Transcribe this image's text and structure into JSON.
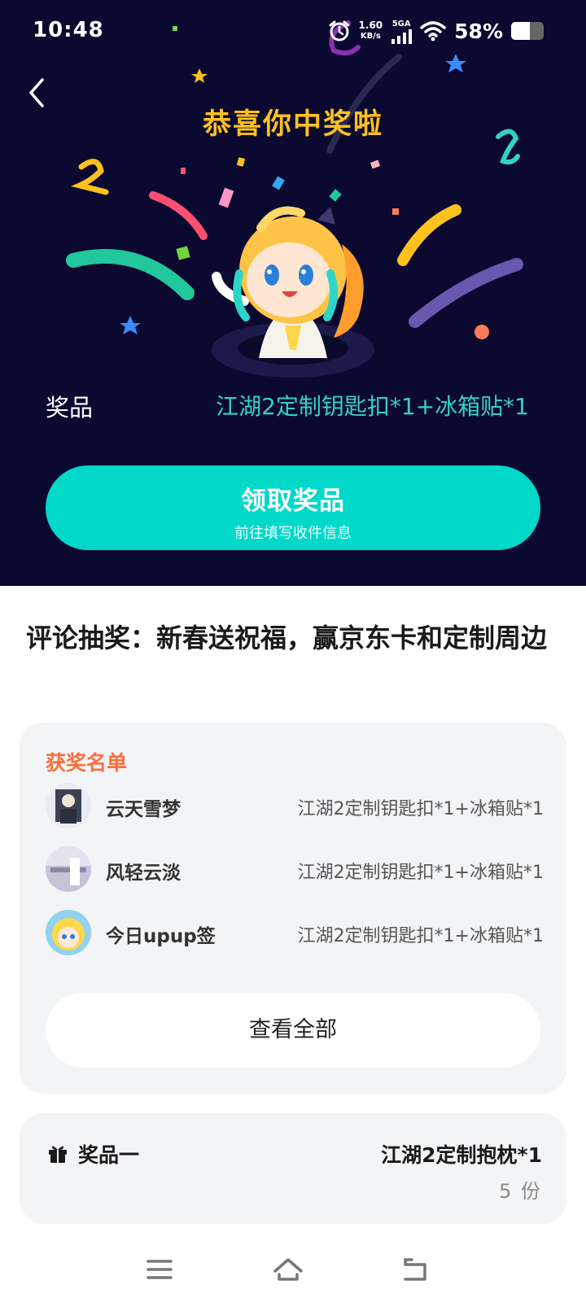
{
  "status_bar": {
    "time": "10:48",
    "speed_value": "1.60",
    "speed_unit": "KB/s",
    "network": "5GA",
    "battery_percent": "58%",
    "battery_level": 0.58
  },
  "hero": {
    "title": "恭喜你中奖啦",
    "prize_label": "奖品",
    "prize_value": "江湖2定制钥匙扣*1+冰箱贴*1",
    "claim_button": "领取奖品",
    "claim_subtext": "前往填写收件信息"
  },
  "activity": {
    "title": "评论抽奖：新春送祝福，赢京东卡和定制周边"
  },
  "winners": {
    "title": "获奖名单",
    "list": [
      {
        "name": "云天雪梦",
        "prize": "江湖2定制钥匙扣*1+冰箱贴*1"
      },
      {
        "name": "风轻云淡",
        "prize": "江湖2定制钥匙扣*1+冰箱贴*1"
      },
      {
        "name": "今日upup签",
        "prize": "江湖2定制钥匙扣*1+冰箱贴*1"
      }
    ],
    "view_all": "查看全部"
  },
  "prize_item": {
    "label": "奖品一",
    "name": "江湖2定制抱枕*1",
    "count": "5 份"
  },
  "colors": {
    "hero_bg": "#0b0930",
    "title_gold": "#ffc21c",
    "accent_teal": "#00d8c9",
    "prize_teal": "#33d3c2",
    "winners_orange": "#fb6f3c"
  },
  "icons": [
    "back-arrow-icon",
    "alarm-icon",
    "signal-icon",
    "wifi-icon",
    "battery-icon",
    "gift-icon",
    "menu-icon",
    "home-icon",
    "return-icon"
  ]
}
